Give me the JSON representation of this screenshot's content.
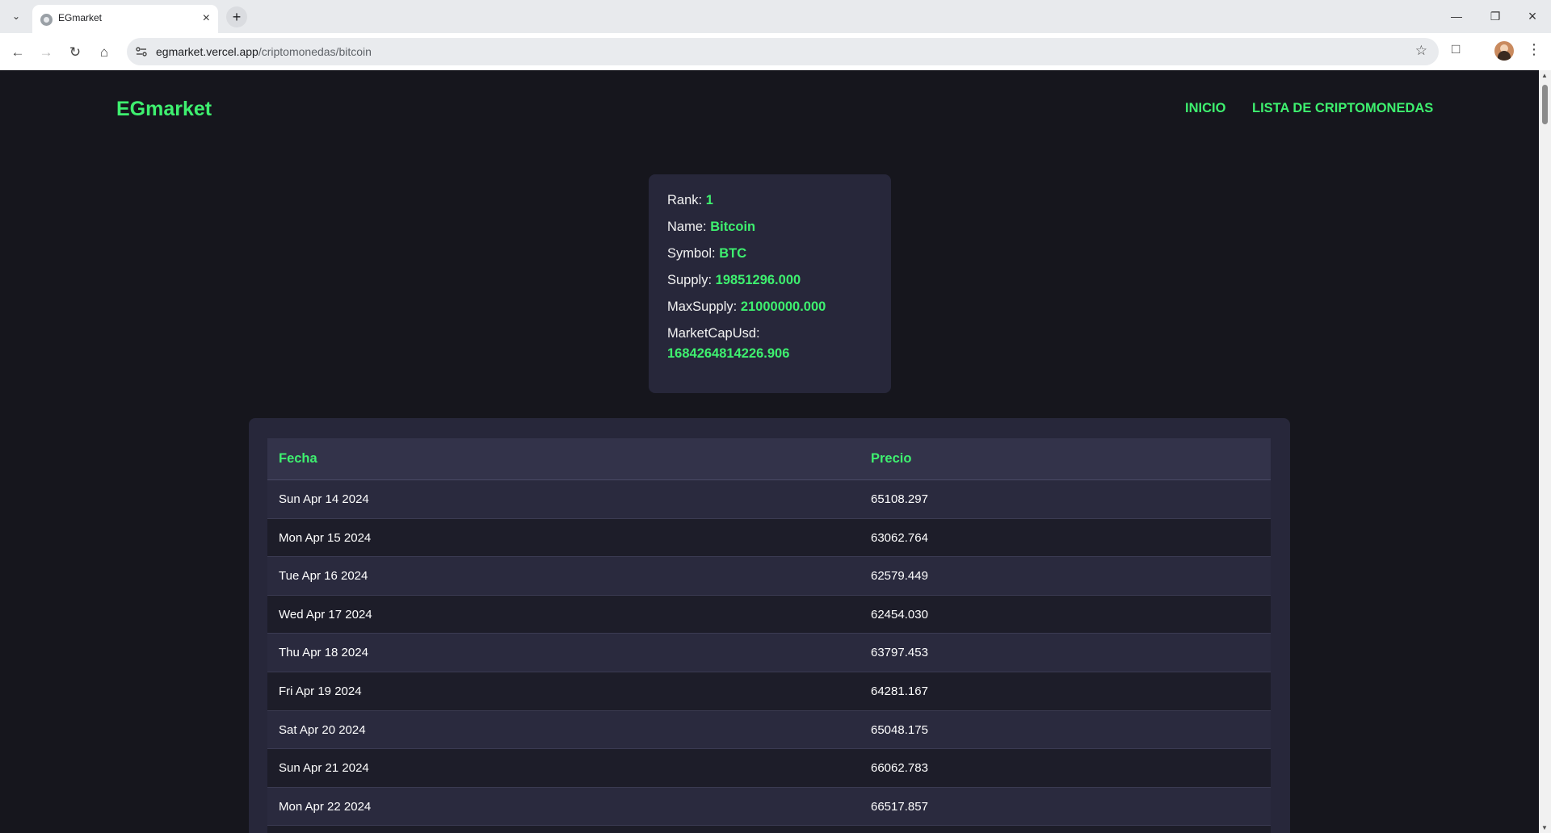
{
  "browser": {
    "tab_title": "EGmarket",
    "new_tab_glyph": "+",
    "url_host": "egmarket.vercel.app",
    "url_path": "/criptomonedas/bitcoin",
    "icons": [
      "tab-list-icon",
      "close-icon",
      "minimize-icon",
      "restore-icon",
      "back-icon",
      "forward-icon",
      "reload-icon",
      "home-icon",
      "site-info-icon",
      "bookmark-star-icon",
      "extensions-icon",
      "avatar",
      "kebab-menu-icon"
    ]
  },
  "header": {
    "logo": "EGmarket",
    "nav": [
      "INICIO",
      "LISTA DE CRIPTOMONEDAS"
    ]
  },
  "coin": {
    "rank_label": "Rank:",
    "rank": "1",
    "name_label": "Name:",
    "name": "Bitcoin",
    "symbol_label": "Symbol:",
    "symbol": "BTC",
    "supply_label": "Supply:",
    "supply": "19851296.000",
    "maxsupply_label": "MaxSupply:",
    "maxsupply": "21000000.000",
    "marketcap_label": "MarketCapUsd:",
    "marketcap": "1684264814226.906"
  },
  "history": {
    "headers": [
      "Fecha",
      "Precio"
    ],
    "rows": [
      {
        "fecha": "Sun Apr 14 2024",
        "precio": "65108.297"
      },
      {
        "fecha": "Mon Apr 15 2024",
        "precio": "63062.764"
      },
      {
        "fecha": "Tue Apr 16 2024",
        "precio": "62579.449"
      },
      {
        "fecha": "Wed Apr 17 2024",
        "precio": "62454.030"
      },
      {
        "fecha": "Thu Apr 18 2024",
        "precio": "63797.453"
      },
      {
        "fecha": "Fri Apr 19 2024",
        "precio": "64281.167"
      },
      {
        "fecha": "Sat Apr 20 2024",
        "precio": "65048.175"
      },
      {
        "fecha": "Sun Apr 21 2024",
        "precio": "66062.783"
      },
      {
        "fecha": "Mon Apr 22 2024",
        "precio": "66517.857"
      }
    ]
  },
  "colors": {
    "accent": "#3ef06f",
    "background": "#16161d",
    "card": "#27273a"
  }
}
